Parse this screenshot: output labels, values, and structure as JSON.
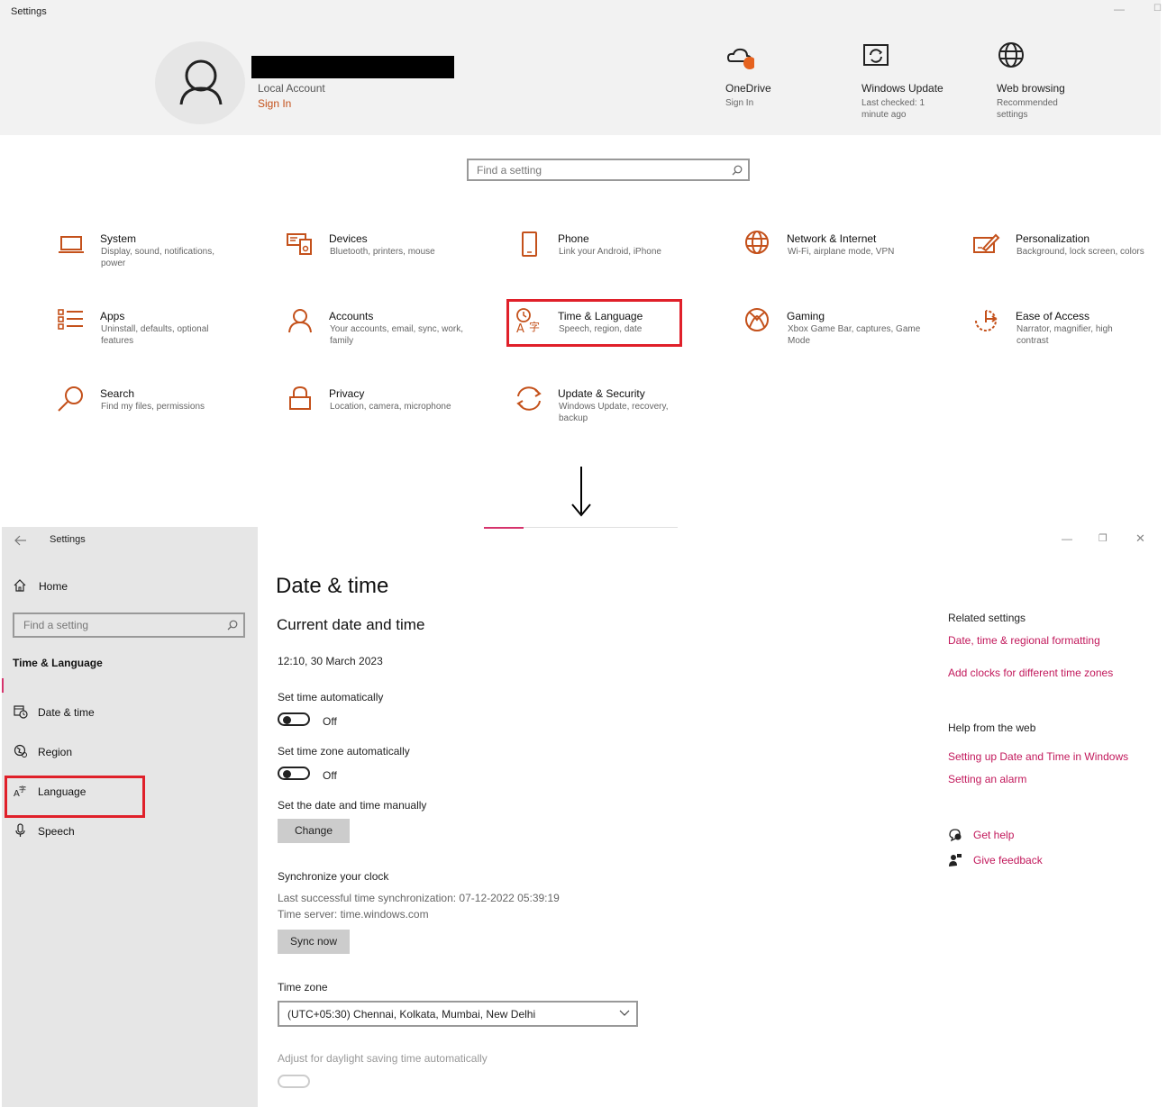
{
  "top": {
    "window_title": "Settings",
    "account": {
      "type": "Local Account",
      "sign_in": "Sign In"
    },
    "header_tiles": [
      {
        "icon": "onedrive-icon",
        "title": "OneDrive",
        "sub": "Sign In"
      },
      {
        "icon": "windows-update-icon",
        "title": "Windows Update",
        "sub": "Last checked: 1 minute ago"
      },
      {
        "icon": "web-browsing-icon",
        "title": "Web browsing",
        "sub": "Recommended settings"
      }
    ],
    "search_placeholder": "Find a setting",
    "categories": [
      {
        "icon": "laptop-icon",
        "title": "System",
        "desc": "Display, sound, notifications, power"
      },
      {
        "icon": "devices-icon",
        "title": "Devices",
        "desc": "Bluetooth, printers, mouse"
      },
      {
        "icon": "phone-icon",
        "title": "Phone",
        "desc": "Link your Android, iPhone"
      },
      {
        "icon": "globe-icon",
        "title": "Network & Internet",
        "desc": "Wi-Fi, airplane mode, VPN"
      },
      {
        "icon": "personalization-icon",
        "title": "Personalization",
        "desc": "Background, lock screen, colors"
      },
      {
        "icon": "apps-icon",
        "title": "Apps",
        "desc": "Uninstall, defaults, optional features"
      },
      {
        "icon": "accounts-icon",
        "title": "Accounts",
        "desc": "Your accounts, email, sync, work, family"
      },
      {
        "icon": "time-language-icon",
        "title": "Time & Language",
        "desc": "Speech, region, date"
      },
      {
        "icon": "xbox-icon",
        "title": "Gaming",
        "desc": "Xbox Game Bar, captures, Game Mode"
      },
      {
        "icon": "ease-of-access-icon",
        "title": "Ease of Access",
        "desc": "Narrator, magnifier, high contrast"
      },
      {
        "icon": "search-icon",
        "title": "Search",
        "desc": "Find my files, permissions"
      },
      {
        "icon": "lock-icon",
        "title": "Privacy",
        "desc": "Location, camera, microphone"
      },
      {
        "icon": "update-icon",
        "title": "Update & Security",
        "desc": "Windows Update, recovery, backup"
      }
    ],
    "highlighted_category": "Time & Language"
  },
  "bottom": {
    "window_title": "Settings",
    "sidebar": {
      "home": "Home",
      "search_placeholder": "Find a setting",
      "section": "Time & Language",
      "items": [
        {
          "icon": "calendar-clock-icon",
          "label": "Date & time"
        },
        {
          "icon": "region-icon",
          "label": "Region"
        },
        {
          "icon": "language-icon",
          "label": "Language"
        },
        {
          "icon": "microphone-icon",
          "label": "Speech"
        }
      ],
      "highlighted_item": "Language"
    },
    "main": {
      "title": "Date & time",
      "section_title": "Current date and time",
      "current": "12:10, 30 March 2023",
      "set_time_auto": {
        "label": "Set time automatically",
        "state": "Off"
      },
      "set_tz_auto": {
        "label": "Set time zone automatically",
        "state": "Off"
      },
      "manual": {
        "label": "Set the date and time manually",
        "button": "Change"
      },
      "sync": {
        "label": "Synchronize your clock",
        "last": "Last successful time synchronization: 07-12-2022 05:39:19",
        "server": "Time server: time.windows.com",
        "button": "Sync now"
      },
      "timezone": {
        "label": "Time zone",
        "value": "(UTC+05:30) Chennai, Kolkata, Mumbai, New Delhi"
      },
      "dst_label": "Adjust for daylight saving time automatically"
    },
    "related": {
      "heading": "Related settings",
      "links": [
        "Date, time & regional formatting",
        "Add clocks for different time zones"
      ]
    },
    "help": {
      "heading": "Help from the web",
      "links": [
        "Setting up Date and Time in Windows",
        "Setting an alarm"
      ]
    },
    "footer": {
      "get_help": "Get help",
      "give_feedback": "Give feedback"
    }
  },
  "colors": {
    "accent": "#c2185b",
    "highlight_border": "#e0202a",
    "sidebar_bg": "#e6e6e6",
    "header_bg": "#f2f2f2",
    "signin": "#c4511b"
  }
}
